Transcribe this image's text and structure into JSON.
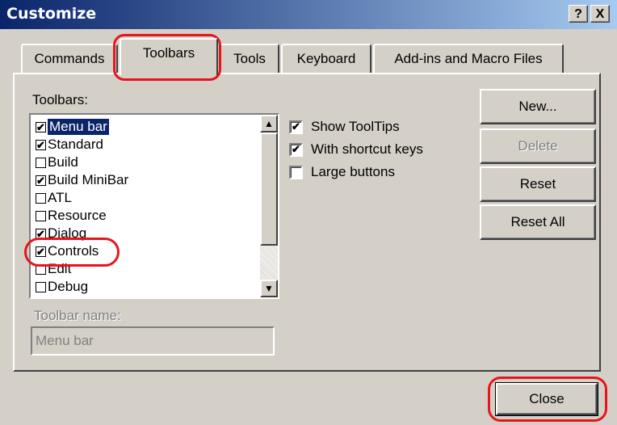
{
  "window": {
    "title": "Customize",
    "help_glyph": "?",
    "close_glyph": "X"
  },
  "tabs": [
    {
      "label": "Commands"
    },
    {
      "label": "Toolbars"
    },
    {
      "label": "Tools"
    },
    {
      "label": "Keyboard"
    },
    {
      "label": "Add-ins and Macro Files"
    }
  ],
  "toolbars_list": {
    "label": "Toolbars:",
    "items": [
      {
        "label": "Menu bar",
        "checked": true,
        "selected": true
      },
      {
        "label": "Standard",
        "checked": true
      },
      {
        "label": "Build",
        "checked": false
      },
      {
        "label": "Build MiniBar",
        "checked": true
      },
      {
        "label": "ATL",
        "checked": false
      },
      {
        "label": "Resource",
        "checked": false
      },
      {
        "label": "Dialog",
        "checked": true
      },
      {
        "label": "Controls",
        "checked": true
      },
      {
        "label": "Edit",
        "checked": false
      },
      {
        "label": "Debug",
        "checked": false
      }
    ]
  },
  "toolbar_name": {
    "label": "Toolbar name:",
    "value": "Menu bar"
  },
  "options": [
    {
      "label": "Show ToolTips",
      "checked": true
    },
    {
      "label": "With shortcut keys",
      "checked": true
    },
    {
      "label": "Large buttons",
      "checked": false
    }
  ],
  "buttons": {
    "new": "New...",
    "delete": "Delete",
    "reset": "Reset",
    "reset_all": "Reset All",
    "close": "Close"
  },
  "colors": {
    "highlight_ring": "#e8141c",
    "selection": "#0a246a",
    "face": "#d4d0c8"
  }
}
